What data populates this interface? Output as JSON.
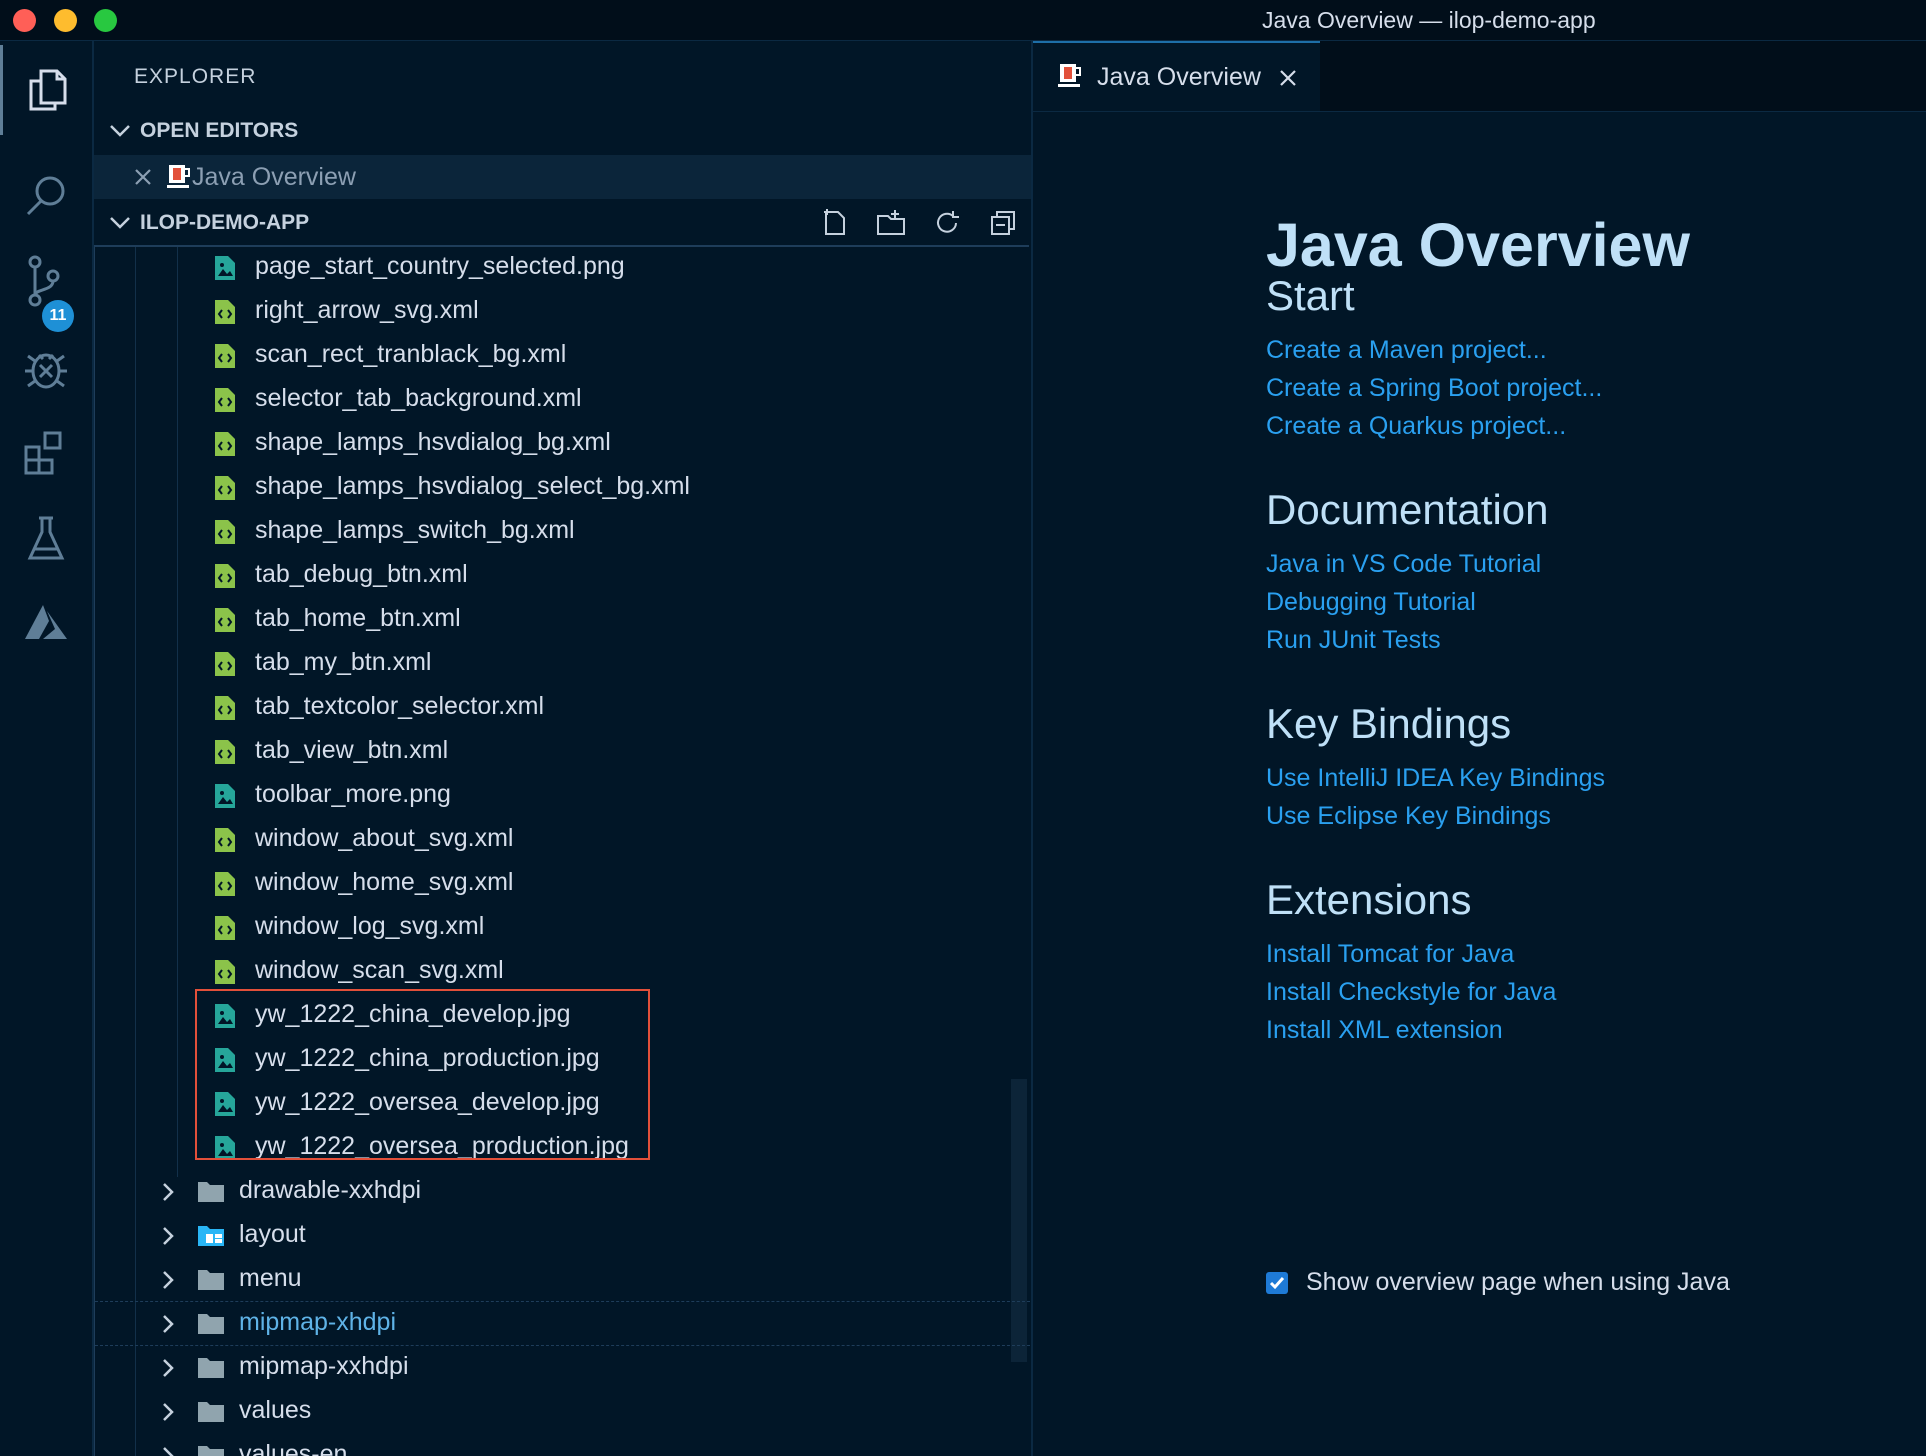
{
  "window": {
    "title": "Java Overview — ilop-demo-app"
  },
  "activity_bar": {
    "scm_badge": "11"
  },
  "explorer": {
    "title": "EXPLORER",
    "open_editors_header": "OPEN EDITORS",
    "open_editor_item": "Java Overview",
    "project_header": "ILOP-DEMO-APP",
    "files": [
      {
        "name": "page_start_country_selected.png",
        "type": "image"
      },
      {
        "name": "right_arrow_svg.xml",
        "type": "xml"
      },
      {
        "name": "scan_rect_tranblack_bg.xml",
        "type": "xml"
      },
      {
        "name": "selector_tab_background.xml",
        "type": "xml"
      },
      {
        "name": "shape_lamps_hsvdialog_bg.xml",
        "type": "xml"
      },
      {
        "name": "shape_lamps_hsvdialog_select_bg.xml",
        "type": "xml"
      },
      {
        "name": "shape_lamps_switch_bg.xml",
        "type": "xml"
      },
      {
        "name": "tab_debug_btn.xml",
        "type": "xml"
      },
      {
        "name": "tab_home_btn.xml",
        "type": "xml"
      },
      {
        "name": "tab_my_btn.xml",
        "type": "xml"
      },
      {
        "name": "tab_textcolor_selector.xml",
        "type": "xml"
      },
      {
        "name": "tab_view_btn.xml",
        "type": "xml"
      },
      {
        "name": "toolbar_more.png",
        "type": "image"
      },
      {
        "name": "window_about_svg.xml",
        "type": "xml"
      },
      {
        "name": "window_home_svg.xml",
        "type": "xml"
      },
      {
        "name": "window_log_svg.xml",
        "type": "xml"
      },
      {
        "name": "window_scan_svg.xml",
        "type": "xml"
      },
      {
        "name": "yw_1222_china_develop.jpg",
        "type": "image"
      },
      {
        "name": "yw_1222_china_production.jpg",
        "type": "image"
      },
      {
        "name": "yw_1222_oversea_develop.jpg",
        "type": "image"
      },
      {
        "name": "yw_1222_oversea_production.jpg",
        "type": "image"
      }
    ],
    "folders": [
      {
        "name": "drawable-xxhdpi",
        "special": false
      },
      {
        "name": "layout",
        "special": true
      },
      {
        "name": "menu",
        "special": false
      },
      {
        "name": "mipmap-xhdpi",
        "special": false
      },
      {
        "name": "mipmap-xxhdpi",
        "special": false
      },
      {
        "name": "values",
        "special": false
      },
      {
        "name": "values-en",
        "special": false
      }
    ]
  },
  "editor": {
    "tab_label": "Java Overview",
    "title": "Java Overview",
    "sections": [
      {
        "heading": "Start",
        "links": [
          "Create a Maven project...",
          "Create a Spring Boot project...",
          "Create a Quarkus project..."
        ]
      },
      {
        "heading": "Documentation",
        "links": [
          "Java in VS Code Tutorial",
          "Debugging Tutorial",
          "Run JUnit Tests"
        ]
      },
      {
        "heading": "Key Bindings",
        "links": [
          "Use IntelliJ IDEA Key Bindings",
          "Use Eclipse Key Bindings"
        ]
      },
      {
        "heading": "Extensions",
        "links": [
          "Install Tomcat for Java",
          "Install Checkstyle for Java",
          "Install XML extension"
        ]
      }
    ],
    "checkbox_label": "Show overview page when using Java",
    "checkbox_checked": true
  },
  "colors": {
    "background": "#011627",
    "link": "#2aa0f0",
    "heading": "#bfe0f7",
    "highlight_box": "#e2503a",
    "xml_icon": "#8bc34a",
    "image_icon": "#26a69a"
  }
}
